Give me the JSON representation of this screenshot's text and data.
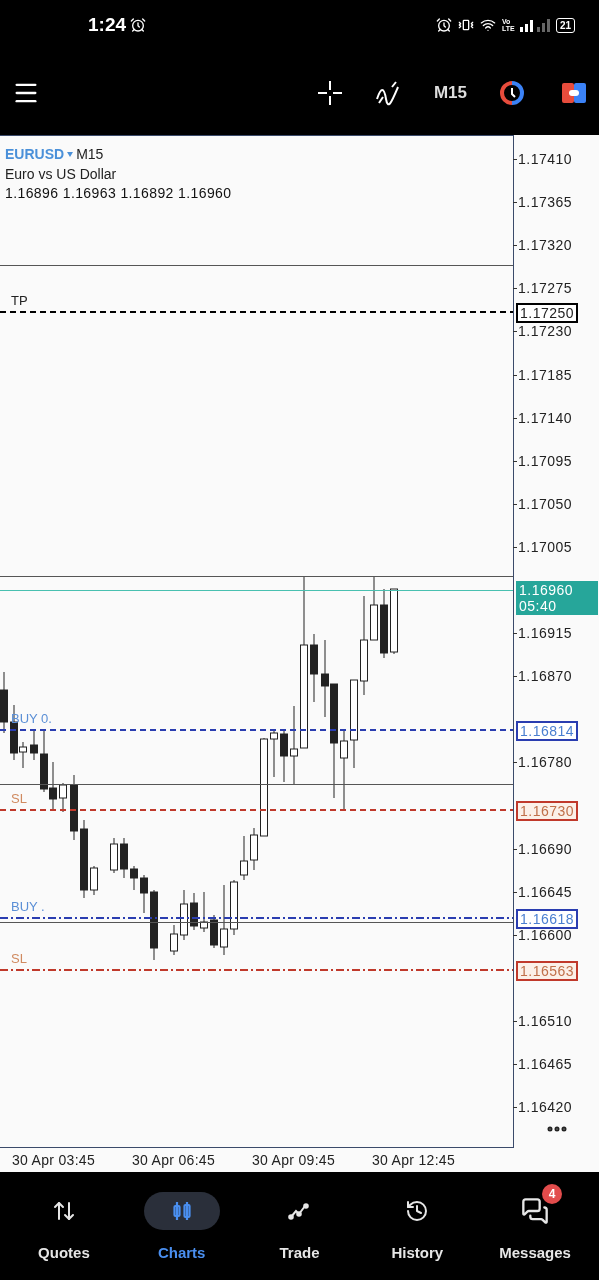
{
  "status_bar": {
    "time": "1:24",
    "network": "Vo LTE",
    "battery": "21"
  },
  "toolbar": {
    "timeframe": "M15"
  },
  "chart": {
    "symbol": "EURUSD",
    "timeframe": "M15",
    "description": "Euro vs US Dollar",
    "ohlc": "1.16896 1.16963 1.16892 1.16960",
    "price_ticks": [
      "1.17410",
      "1.17365",
      "1.17320",
      "1.17275",
      "1.17230",
      "1.17185",
      "1.17140",
      "1.17095",
      "1.17050",
      "1.17005",
      "1.16915",
      "1.16870",
      "1.16780",
      "1.16690",
      "1.16645",
      "1.16600",
      "1.16510",
      "1.16465",
      "1.16420"
    ],
    "lines": [
      {
        "kind": "takeprofit",
        "label": "TP",
        "price": "1.17250",
        "color": "#000000"
      },
      {
        "kind": "buy",
        "label": "BUY 0.",
        "price": "1.16814",
        "color": "#2a3db0"
      },
      {
        "kind": "stoploss",
        "label": "SL",
        "price": "1.16730",
        "color": "#c0392b"
      },
      {
        "kind": "buylimit",
        "label": "BUY .",
        "price": "1.16618",
        "color": "#2a3db0"
      },
      {
        "kind": "stoplimit",
        "label": "SL",
        "price": "1.16563",
        "color": "#c0392b"
      }
    ],
    "bid": {
      "price": "1.16960",
      "countdown": "05:40"
    },
    "time_labels": [
      "30 Apr 03:45",
      "30 Apr 06:45",
      "30 Apr 09:45",
      "30 Apr 12:45"
    ]
  },
  "nav": [
    {
      "label": "Quotes",
      "selected": false
    },
    {
      "label": "Charts",
      "selected": true
    },
    {
      "label": "Trade",
      "selected": false
    },
    {
      "label": "History",
      "selected": false
    },
    {
      "label": "Messages",
      "selected": false,
      "badge": "4"
    }
  ]
}
